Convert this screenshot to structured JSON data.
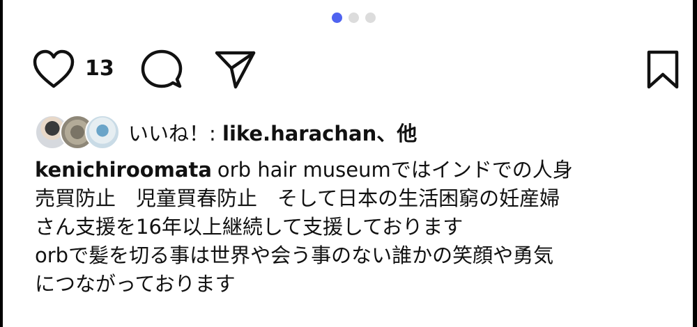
{
  "carousel": {
    "count": 3,
    "active_index": 0,
    "active_color": "#4f63f0",
    "inactive_color": "#dcdcdc"
  },
  "actions": {
    "like_icon": "heart-icon",
    "like_count": "13",
    "comment_icon": "comment-icon",
    "share_icon": "send-icon",
    "save_icon": "bookmark-icon"
  },
  "liked_by": {
    "prefix": "いいね！: ",
    "user": "like.harachan、他",
    "avatars": [
      "avatar-1",
      "avatar-2",
      "avatar-3"
    ]
  },
  "caption": {
    "author": "kenichiroomata",
    "lines_paragraph_1": [
      "orb hair museumではインドでの人身",
      "売買防止　児童買春防止　そして日本の生活困窮の妊産婦",
      "さん支援を16年以上継続して支援しております"
    ],
    "lines_paragraph_2": [
      "orbで髪を切る事は世界や会う事のない誰かの笑顔や勇気",
      "につながっております"
    ]
  }
}
